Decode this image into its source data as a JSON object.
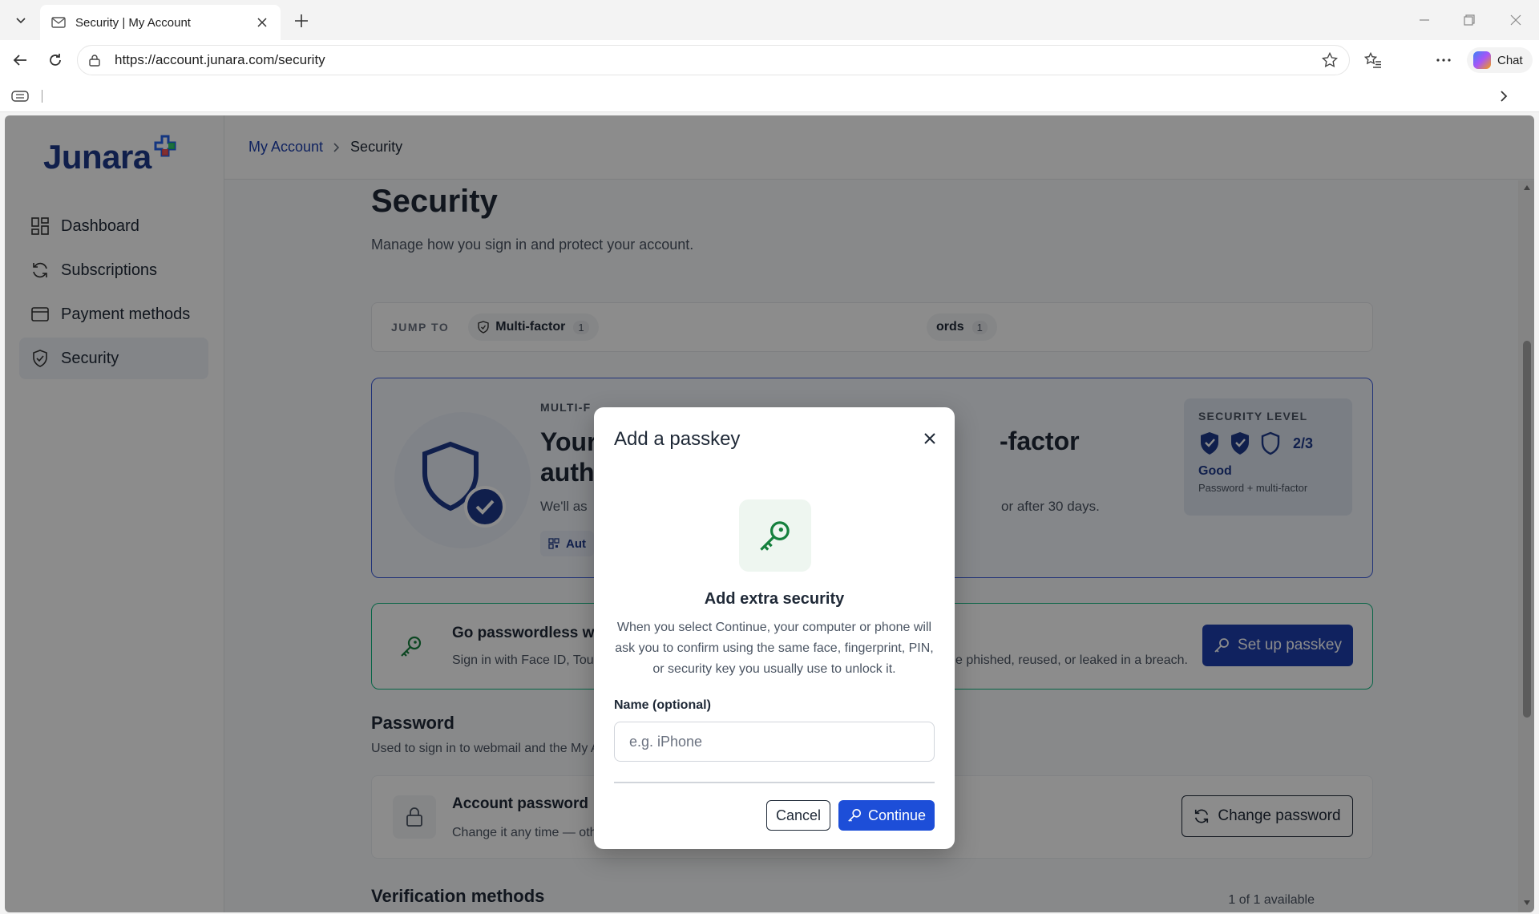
{
  "browser": {
    "tab_title": "Security | My Account",
    "url": "https://account.junara.com/security",
    "chat_label": "Chat"
  },
  "brand": {
    "name": "Junara"
  },
  "sidebar": {
    "items": [
      {
        "label": "Dashboard",
        "icon": "dashboard-icon"
      },
      {
        "label": "Subscriptions",
        "icon": "refresh-icon"
      },
      {
        "label": "Payment methods",
        "icon": "card-icon"
      },
      {
        "label": "Security",
        "icon": "shield-check-icon",
        "active": true
      }
    ]
  },
  "breadcrumb": {
    "parent": "My Account",
    "current": "Security"
  },
  "page": {
    "title": "Security",
    "subtitle": "Manage how you sign in and protect your account."
  },
  "jump": {
    "label": "JUMP TO",
    "chips": [
      {
        "label": "Multi-factor",
        "count": "1"
      },
      {
        "label": "ords",
        "count": "1"
      }
    ]
  },
  "mfa": {
    "eyebrow": "MULTI-F",
    "headline_left": "Your",
    "headline_left2": "auth",
    "headline_right": "-factor",
    "desc_left": "We'll as",
    "desc_right": "or after 30 days.",
    "pill": "Aut",
    "level": {
      "title": "SECURITY LEVEL",
      "fraction": "2/3",
      "rating": "Good",
      "detail": "Password + multi-factor",
      "filled": 2,
      "total": 3
    }
  },
  "passwordless": {
    "title": "Go passwordless wit",
    "desc_left": "Sign in with Face ID, Tou",
    "desc_right": "e phished, reused, or leaked in a breach.",
    "button": "Set up passkey"
  },
  "password_section": {
    "title": "Password",
    "desc": "Used to sign in to webmail and the My Account dashboard.",
    "card_title": "Account password",
    "card_desc": "Change it any time — other sessions are signed out afterwards.",
    "button": "Change password"
  },
  "verification": {
    "title": "Verification methods",
    "available": "1 of 1 available"
  },
  "modal": {
    "title": "Add a passkey",
    "heading": "Add extra security",
    "body": "When you select Continue, your computer or phone will ask you to confirm using the same face, fingerprint, PIN, or security key you usually use to unlock it.",
    "field_label": "Name (optional)",
    "field_placeholder": "e.g. iPhone",
    "field_value": "",
    "cancel": "Cancel",
    "continue": "Continue"
  },
  "colors": {
    "brand_navy": "#1e3a8a",
    "primary": "#1d4ed8",
    "success": "#10b981",
    "key_green": "#15803d"
  }
}
